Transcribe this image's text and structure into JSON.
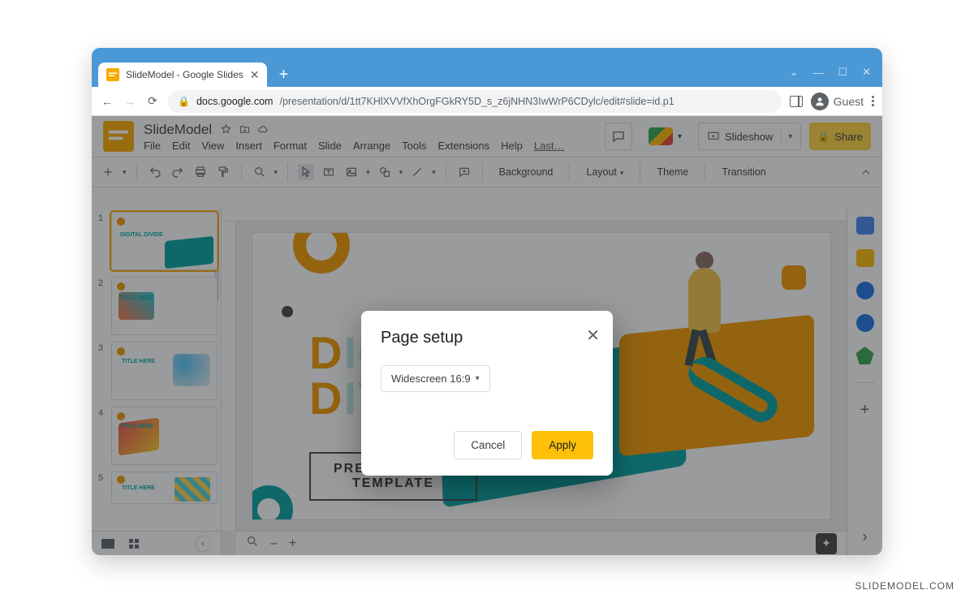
{
  "window": {
    "tab_title": "SlideModel - Google Slides",
    "guest_label": "Guest",
    "url_host": "docs.google.com",
    "url_path": "/presentation/d/1tt7KHlXVVfXhOrgFGkRY5D_s_z6jNHN3IwWrP6CDylc/edit#slide=id.p1"
  },
  "doc": {
    "title": "SlideModel",
    "menus": [
      "File",
      "Edit",
      "View",
      "Insert",
      "Format",
      "Slide",
      "Arrange",
      "Tools",
      "Extensions",
      "Help"
    ],
    "last_edit": "Last…",
    "slideshow_label": "Slideshow",
    "share_label": "Share"
  },
  "toolbar": {
    "background": "Background",
    "layout": "Layout",
    "theme": "Theme",
    "transition": "Transition"
  },
  "thumbnails": [
    {
      "n": "1",
      "label": "DIGITAL DIVIDE"
    },
    {
      "n": "2",
      "label": "TITLE HERE"
    },
    {
      "n": "3",
      "label": "TITLE HERE"
    },
    {
      "n": "4",
      "label": "TITLE HERE"
    },
    {
      "n": "5",
      "label": "TITLE HERE"
    }
  ],
  "slide": {
    "title_line1_a": "D",
    "title_line1_b": "IGITAL",
    "title_line2_a": "D",
    "title_line2_b": "IVIDE",
    "subtitle_line1": "PRESENTATION",
    "subtitle_line2": "TEMPLATE"
  },
  "dialog": {
    "title": "Page setup",
    "selected": "Widescreen 16:9",
    "cancel": "Cancel",
    "apply": "Apply"
  },
  "watermark": "SLIDEMODEL.COM"
}
